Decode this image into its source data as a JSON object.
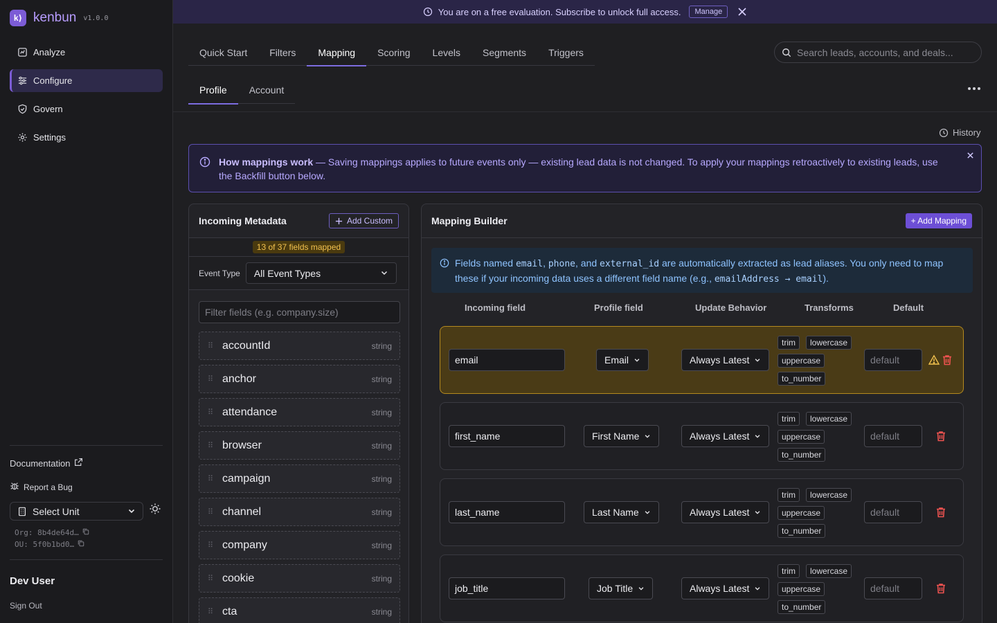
{
  "app": {
    "name": "kenbun",
    "version": "v1.0.0",
    "logo_letter": "k⟩"
  },
  "sidebar": {
    "items": [
      {
        "label": "Analyze",
        "icon": "chart-square-icon",
        "active": false
      },
      {
        "label": "Configure",
        "icon": "sliders-icon",
        "active": true
      },
      {
        "label": "Govern",
        "icon": "shield-check-icon",
        "active": false
      },
      {
        "label": "Settings",
        "icon": "gear-icon",
        "active": false
      }
    ],
    "documentation": "Documentation",
    "report_bug": "Report a Bug",
    "unit_select": "Select Unit",
    "org": "Org: 8b4de64d…",
    "ou": "OU: 5f0b1bd0…",
    "user": "Dev User",
    "sign_out": "Sign Out"
  },
  "banner": {
    "text": "You are on a free evaluation. Subscribe to unlock full access.",
    "manage": "Manage"
  },
  "tabs": [
    "Quick Start",
    "Filters",
    "Mapping",
    "Scoring",
    "Levels",
    "Segments",
    "Triggers"
  ],
  "active_tab": "Mapping",
  "subtabs": [
    "Profile",
    "Account"
  ],
  "active_subtab": "Profile",
  "search": {
    "placeholder": "Search leads, accounts, and deals..."
  },
  "history": "History",
  "info": {
    "title": "How mappings work",
    "text": " — Saving mappings applies to future events only — existing lead data is not changed. To apply your mappings retroactively to existing leads, use the Backfill button below."
  },
  "incoming": {
    "title": "Incoming Metadata",
    "add_custom": "Add Custom",
    "mapped": "13 of 37 fields mapped",
    "event_type_label": "Event Type",
    "event_type_value": "All Event Types",
    "filter_placeholder": "Filter fields (e.g. company.size)",
    "fields": [
      {
        "name": "accountId",
        "type": "string"
      },
      {
        "name": "anchor",
        "type": "string"
      },
      {
        "name": "attendance",
        "type": "string"
      },
      {
        "name": "browser",
        "type": "string"
      },
      {
        "name": "campaign",
        "type": "string"
      },
      {
        "name": "channel",
        "type": "string"
      },
      {
        "name": "company",
        "type": "string"
      },
      {
        "name": "cookie",
        "type": "string"
      },
      {
        "name": "cta",
        "type": "string"
      }
    ]
  },
  "builder": {
    "title": "Mapping Builder",
    "add_mapping": "+ Add Mapping",
    "alias": {
      "t1": "Fields named ",
      "c1": "email",
      "t2": ", ",
      "c2": "phone",
      "t3": ", and ",
      "c3": "external_id",
      "t4": " are automatically extracted as lead aliases. You only need to map these if your incoming data uses a different field name (e.g., ",
      "c4": "emailAddress → email",
      "t5": ")."
    },
    "columns": [
      "Incoming field",
      "Profile field",
      "Update Behavior",
      "Transforms",
      "Default"
    ],
    "transforms": [
      "trim",
      "lowercase",
      "uppercase",
      "to_number"
    ],
    "default_placeholder": "default",
    "rows": [
      {
        "incoming": "email",
        "profile": "Email",
        "behavior": "Always Latest",
        "warning": true
      },
      {
        "incoming": "first_name",
        "profile": "First Name",
        "behavior": "Always Latest",
        "warning": false
      },
      {
        "incoming": "last_name",
        "profile": "Last Name",
        "behavior": "Always Latest",
        "warning": false
      },
      {
        "incoming": "job_title",
        "profile": "Job Title",
        "behavior": "Always Latest",
        "warning": false
      }
    ]
  },
  "colors": {
    "accent": "#7c5cd6",
    "warn": "#f2c14e",
    "danger": "#ef5350",
    "info": "#8ec3ff"
  }
}
